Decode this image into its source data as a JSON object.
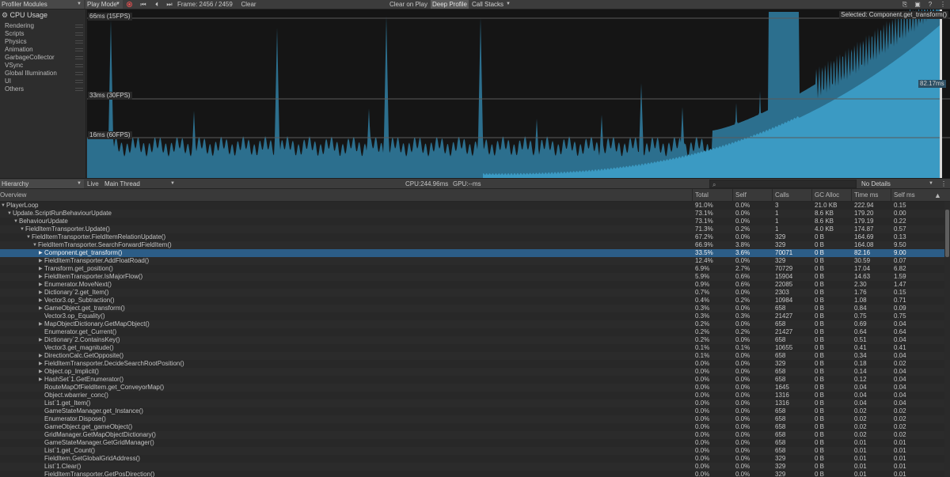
{
  "toolbar": {
    "modules": "Profiler Modules",
    "play_mode": "Play Mode",
    "frame": "Frame: 2456 / 2459",
    "clear": "Clear",
    "clear_on_play": "Clear on Play",
    "deep_profile": "Deep Profile",
    "call_stacks": "Call Stacks"
  },
  "sidebar": {
    "title": "CPU Usage",
    "items": [
      "Rendering",
      "Scripts",
      "Physics",
      "Animation",
      "GarbageCollector",
      "VSync",
      "Global Illumination",
      "UI",
      "Others"
    ]
  },
  "chart": {
    "lines": [
      "66ms (15FPS)",
      "33ms (30FPS)",
      "16ms (60FPS)"
    ],
    "selected": "Selected: Component.get_transform()",
    "current_value": "82.17ms",
    "color_fill": "#2c6f8e",
    "color_highlight": "#3b9ac3"
  },
  "hierarchy_bar": {
    "view": "Hierarchy",
    "live": "Live",
    "thread": "Main Thread",
    "cpu": "CPU:244.96ms",
    "gpu": "GPU:--ms",
    "details": "No Details"
  },
  "table": {
    "columns": [
      "Overview",
      "Total",
      "Self",
      "Calls",
      "GC Alloc",
      "Time ms",
      "Self ms"
    ],
    "rows": [
      {
        "d": 0,
        "t": true,
        "name": "PlayerLoop",
        "total": "91.0%",
        "self": "0.0%",
        "calls": "3",
        "gc": "21.0 KB",
        "time": "222.94",
        "selfms": "0.15"
      },
      {
        "d": 1,
        "t": true,
        "name": "Update.ScriptRunBehaviourUpdate",
        "total": "73.1%",
        "self": "0.0%",
        "calls": "1",
        "gc": "8.6 KB",
        "time": "179.20",
        "selfms": "0.00"
      },
      {
        "d": 2,
        "t": true,
        "name": "BehaviourUpdate",
        "total": "73.1%",
        "self": "0.0%",
        "calls": "1",
        "gc": "8.6 KB",
        "time": "179.19",
        "selfms": "0.22"
      },
      {
        "d": 3,
        "t": true,
        "name": "FieldItemTransporter.Update()",
        "total": "71.3%",
        "self": "0.2%",
        "calls": "1",
        "gc": "4.0 KB",
        "time": "174.87",
        "selfms": "0.57"
      },
      {
        "d": 4,
        "t": true,
        "name": "FieldItemTransporter.FieldItemRelationUpdate()",
        "total": "67.2%",
        "self": "0.0%",
        "calls": "329",
        "gc": "0 B",
        "time": "164.69",
        "selfms": "0.13"
      },
      {
        "d": 5,
        "t": true,
        "name": "FieldItemTransporter.SearchForwardFieldItem()",
        "total": "66.9%",
        "self": "3.8%",
        "calls": "329",
        "gc": "0 B",
        "time": "164.08",
        "selfms": "9.50"
      },
      {
        "d": 6,
        "t": true,
        "sel": true,
        "name": "Component.get_transform()",
        "total": "33.5%",
        "self": "3.6%",
        "calls": "70071",
        "gc": "0 B",
        "time": "82.16",
        "selfms": "9.00"
      },
      {
        "d": 6,
        "t": true,
        "name": "FieldItemTransporter.AddFloatRoad()",
        "total": "12.4%",
        "self": "0.0%",
        "calls": "329",
        "gc": "0 B",
        "time": "30.59",
        "selfms": "0.07"
      },
      {
        "d": 6,
        "t": true,
        "name": "Transform.get_position()",
        "total": "6.9%",
        "self": "2.7%",
        "calls": "70729",
        "gc": "0 B",
        "time": "17.04",
        "selfms": "6.82"
      },
      {
        "d": 6,
        "t": true,
        "name": "FieldItemTransporter.IsMajorFlow()",
        "total": "5.9%",
        "self": "0.6%",
        "calls": "15904",
        "gc": "0 B",
        "time": "14.63",
        "selfms": "1.59"
      },
      {
        "d": 6,
        "t": true,
        "name": "Enumerator.MoveNext()",
        "total": "0.9%",
        "self": "0.6%",
        "calls": "22085",
        "gc": "0 B",
        "time": "2.30",
        "selfms": "1.47"
      },
      {
        "d": 6,
        "t": true,
        "name": "Dictionary`2.get_Item()",
        "total": "0.7%",
        "self": "0.0%",
        "calls": "2303",
        "gc": "0 B",
        "time": "1.76",
        "selfms": "0.15"
      },
      {
        "d": 6,
        "t": true,
        "name": "Vector3.op_Subtraction()",
        "total": "0.4%",
        "self": "0.2%",
        "calls": "10984",
        "gc": "0 B",
        "time": "1.08",
        "selfms": "0.71"
      },
      {
        "d": 6,
        "t": true,
        "name": "GameObject.get_transform()",
        "total": "0.3%",
        "self": "0.0%",
        "calls": "658",
        "gc": "0 B",
        "time": "0.84",
        "selfms": "0.09"
      },
      {
        "d": 6,
        "t": false,
        "name": "Vector3.op_Equality()",
        "total": "0.3%",
        "self": "0.3%",
        "calls": "21427",
        "gc": "0 B",
        "time": "0.75",
        "selfms": "0.75"
      },
      {
        "d": 6,
        "t": true,
        "name": "MapObjectDictionary.GetMapObject()",
        "total": "0.2%",
        "self": "0.0%",
        "calls": "658",
        "gc": "0 B",
        "time": "0.69",
        "selfms": "0.04"
      },
      {
        "d": 6,
        "t": false,
        "name": "Enumerator.get_Current()",
        "total": "0.2%",
        "self": "0.2%",
        "calls": "21427",
        "gc": "0 B",
        "time": "0.64",
        "selfms": "0.64"
      },
      {
        "d": 6,
        "t": true,
        "name": "Dictionary`2.ContainsKey()",
        "total": "0.2%",
        "self": "0.0%",
        "calls": "658",
        "gc": "0 B",
        "time": "0.51",
        "selfms": "0.04"
      },
      {
        "d": 6,
        "t": false,
        "name": "Vector3.get_magnitude()",
        "total": "0.1%",
        "self": "0.1%",
        "calls": "10655",
        "gc": "0 B",
        "time": "0.41",
        "selfms": "0.41"
      },
      {
        "d": 6,
        "t": true,
        "name": "DirectionCalc.GetOpposite()",
        "total": "0.1%",
        "self": "0.0%",
        "calls": "658",
        "gc": "0 B",
        "time": "0.34",
        "selfms": "0.04"
      },
      {
        "d": 6,
        "t": true,
        "name": "FieldItemTransporter.DecideSearchRootPosition()",
        "total": "0.0%",
        "self": "0.0%",
        "calls": "329",
        "gc": "0 B",
        "time": "0.18",
        "selfms": "0.02"
      },
      {
        "d": 6,
        "t": true,
        "name": "Object.op_Implicit()",
        "total": "0.0%",
        "self": "0.0%",
        "calls": "658",
        "gc": "0 B",
        "time": "0.14",
        "selfms": "0.04"
      },
      {
        "d": 6,
        "t": true,
        "name": "HashSet`1.GetEnumerator()",
        "total": "0.0%",
        "self": "0.0%",
        "calls": "658",
        "gc": "0 B",
        "time": "0.12",
        "selfms": "0.04"
      },
      {
        "d": 6,
        "t": false,
        "name": "RouteMapOfFieldItem.get_ConveyorMap()",
        "total": "0.0%",
        "self": "0.0%",
        "calls": "1645",
        "gc": "0 B",
        "time": "0.04",
        "selfms": "0.04"
      },
      {
        "d": 6,
        "t": false,
        "name": "Object.wbarrier_conc()",
        "total": "0.0%",
        "self": "0.0%",
        "calls": "1316",
        "gc": "0 B",
        "time": "0.04",
        "selfms": "0.04"
      },
      {
        "d": 6,
        "t": false,
        "name": "List`1.get_Item()",
        "total": "0.0%",
        "self": "0.0%",
        "calls": "1316",
        "gc": "0 B",
        "time": "0.04",
        "selfms": "0.04"
      },
      {
        "d": 6,
        "t": false,
        "name": "GameStateManager.get_Instance()",
        "total": "0.0%",
        "self": "0.0%",
        "calls": "658",
        "gc": "0 B",
        "time": "0.02",
        "selfms": "0.02"
      },
      {
        "d": 6,
        "t": false,
        "name": "Enumerator.Dispose()",
        "total": "0.0%",
        "self": "0.0%",
        "calls": "658",
        "gc": "0 B",
        "time": "0.02",
        "selfms": "0.02"
      },
      {
        "d": 6,
        "t": false,
        "name": "GameObject.get_gameObject()",
        "total": "0.0%",
        "self": "0.0%",
        "calls": "658",
        "gc": "0 B",
        "time": "0.02",
        "selfms": "0.02"
      },
      {
        "d": 6,
        "t": false,
        "name": "GridManager.GetMapObjectDictionary()",
        "total": "0.0%",
        "self": "0.0%",
        "calls": "658",
        "gc": "0 B",
        "time": "0.02",
        "selfms": "0.02"
      },
      {
        "d": 6,
        "t": false,
        "name": "GameStateManager.GetGridManager()",
        "total": "0.0%",
        "self": "0.0%",
        "calls": "658",
        "gc": "0 B",
        "time": "0.01",
        "selfms": "0.01"
      },
      {
        "d": 6,
        "t": false,
        "name": "List`1.get_Count()",
        "total": "0.0%",
        "self": "0.0%",
        "calls": "658",
        "gc": "0 B",
        "time": "0.01",
        "selfms": "0.01"
      },
      {
        "d": 6,
        "t": false,
        "name": "FieldItem.GetGlobalGridAddress()",
        "total": "0.0%",
        "self": "0.0%",
        "calls": "329",
        "gc": "0 B",
        "time": "0.01",
        "selfms": "0.01"
      },
      {
        "d": 6,
        "t": false,
        "name": "List`1.Clear()",
        "total": "0.0%",
        "self": "0.0%",
        "calls": "329",
        "gc": "0 B",
        "time": "0.01",
        "selfms": "0.01"
      },
      {
        "d": 6,
        "t": false,
        "name": "FieldItemTransporter.GetPosDirection()",
        "total": "0.0%",
        "self": "0.0%",
        "calls": "329",
        "gc": "0 B",
        "time": "0.01",
        "selfms": "0.01"
      }
    ]
  }
}
